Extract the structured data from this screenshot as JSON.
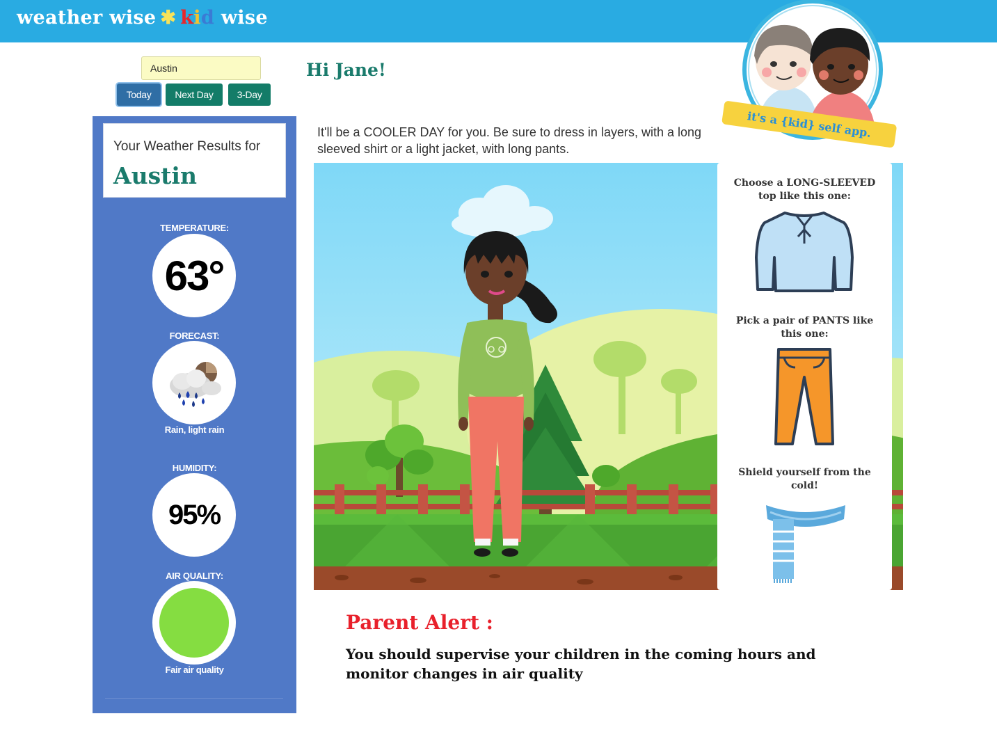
{
  "header": {
    "brand_part1": "weather wise",
    "brand_star": "✱",
    "brand_k": "k",
    "brand_i": "i",
    "brand_d": "d",
    "brand_part2": "wise",
    "badge_text": "it's a {kid} self app."
  },
  "controls": {
    "city_value": "Austin",
    "buttons": [
      "Today",
      "Next Day",
      "3-Day"
    ]
  },
  "greeting": "Hi Jane!",
  "sidebar": {
    "results_label": "Your Weather Results for",
    "city": "Austin",
    "temperature_title": "TEMPERATURE:",
    "temperature_value": "63°",
    "forecast_title": "FORECAST:",
    "forecast_icon": "rain-cloud-icon",
    "forecast_caption": "Rain, light rain",
    "humidity_title": "HUMIDITY:",
    "humidity_value": "95%",
    "air_quality_title": "AIR QUALITY:",
    "air_quality_color": "#85dd41",
    "air_quality_caption": "Fair air quality"
  },
  "message": "It'll be a COOLER DAY for you. Be sure to dress in layers, with a long sleeved shirt or a light jacket, with long pants.",
  "clothing": {
    "top_text": "Choose a LONG-SLEEVED top like this one:",
    "pants_text": "Pick a pair of PANTS like this one:",
    "scarf_text": "Shield yourself from the cold!"
  },
  "alert": {
    "title": "Parent Alert :",
    "text": "You should supervise your children in the coming hours and monitor changes in air quality"
  },
  "colors": {
    "header": "#29abe2",
    "sidebar": "#5079c7",
    "accent_green": "#1a7b6c",
    "alert_red": "#e8202b"
  }
}
